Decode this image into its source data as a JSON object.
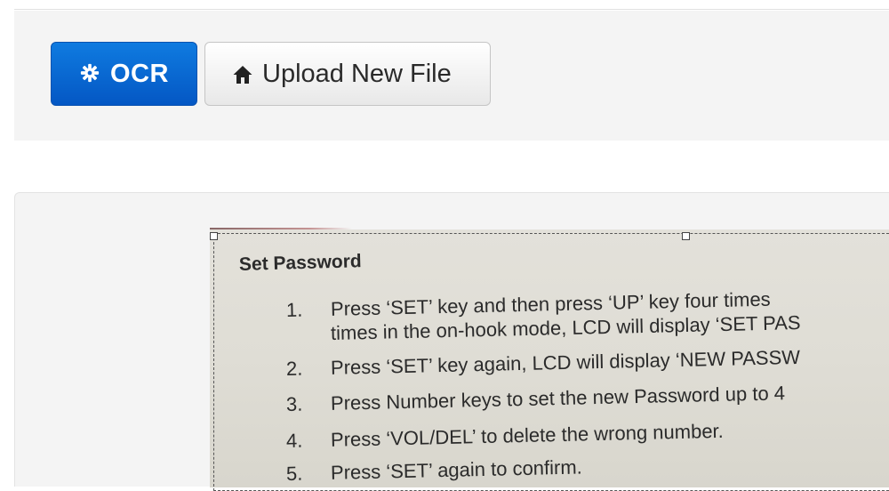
{
  "toolbar": {
    "ocr_label": "OCR",
    "ocr_icon": "gear-icon",
    "upload_label": "Upload New File",
    "upload_icon": "home-icon",
    "accent_color": "#0a66d6"
  },
  "document": {
    "title": "Set Password",
    "steps": [
      {
        "num": "1.",
        "text": "Press ‘SET’ key and then press ‘UP’ key four times",
        "cont": "times in the on-hook mode, LCD will display ‘SET PAS"
      },
      {
        "num": "2.",
        "text": "Press ‘SET’ key again, LCD will display ‘NEW PASSW"
      },
      {
        "num": "3.",
        "text": "Press Number keys to set the new Password up to 4"
      },
      {
        "num": "4.",
        "text": "Press ‘VOL/DEL’ to delete the wrong number."
      },
      {
        "num": "5.",
        "text": "Press ‘SET’ again to confirm."
      }
    ]
  }
}
